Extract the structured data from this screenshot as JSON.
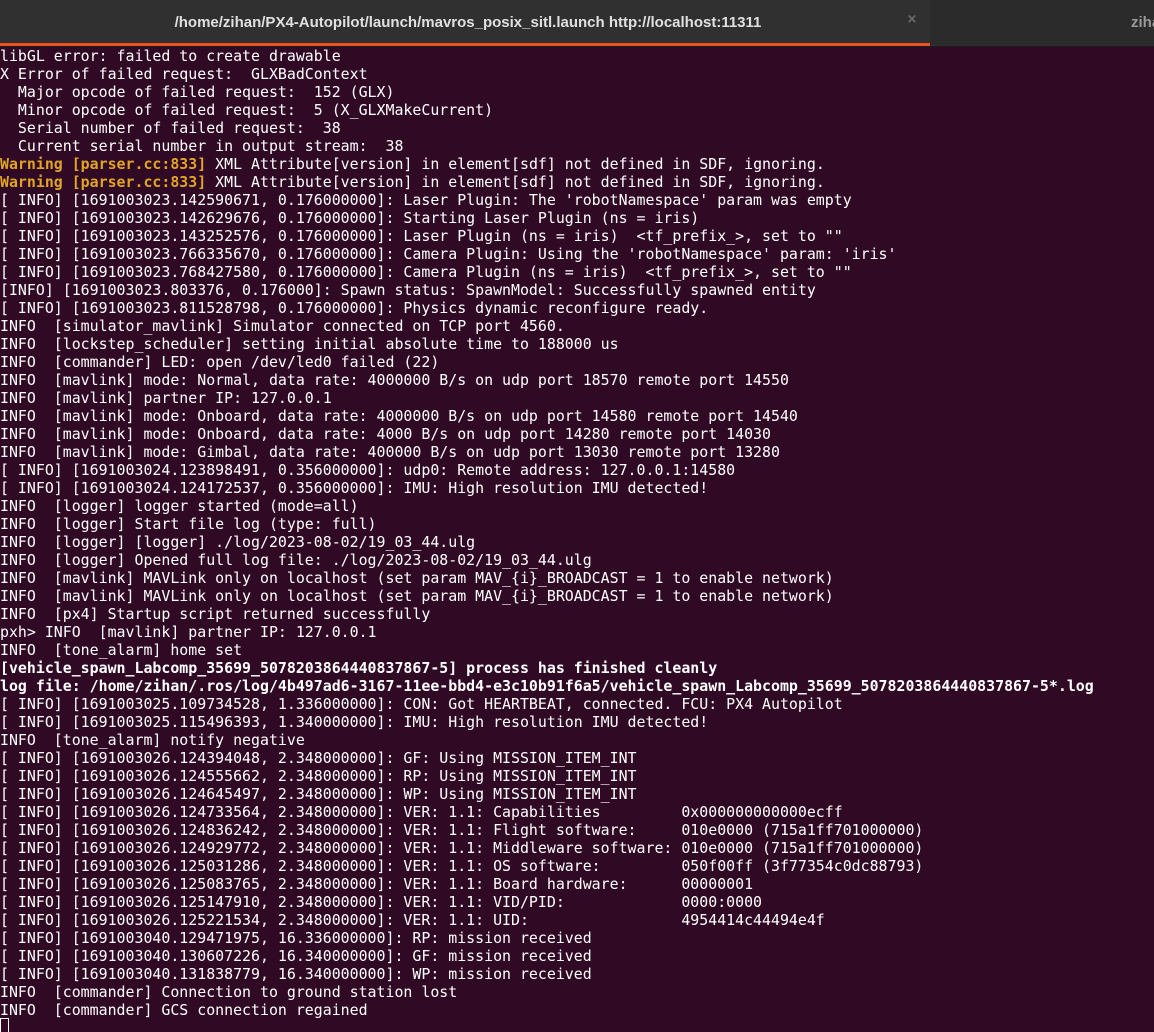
{
  "tabs": {
    "active_title": "/home/zihan/PX4-Autopilot/launch/mavros_posix_sitl.launch http://localhost:11311",
    "close_symbol": "×",
    "inactive_title": "ziha",
    "accent_color": "#e95420"
  },
  "colors": {
    "background": "#300a24",
    "warning": "#e0a526",
    "text": "#ffffff"
  },
  "terminal": {
    "lines": [
      {
        "text": "libGL error: failed to create drawable"
      },
      {
        "text": "X Error of failed request:  GLXBadContext"
      },
      {
        "text": "  Major opcode of failed request:  152 (GLX)"
      },
      {
        "text": "  Minor opcode of failed request:  5 (X_GLXMakeCurrent)"
      },
      {
        "text": "  Serial number of failed request:  38"
      },
      {
        "text": "  Current serial number in output stream:  38"
      },
      {
        "warn": "Warning [parser.cc:833]",
        "text": " XML Attribute[version] in element[sdf] not defined in SDF, ignoring."
      },
      {
        "warn": "Warning [parser.cc:833]",
        "text": " XML Attribute[version] in element[sdf] not defined in SDF, ignoring."
      },
      {
        "text": "[ INFO] [1691003023.142590671, 0.176000000]: Laser Plugin: The 'robotNamespace' param was empty"
      },
      {
        "text": "[ INFO] [1691003023.142629676, 0.176000000]: Starting Laser Plugin (ns = iris)"
      },
      {
        "text": "[ INFO] [1691003023.143252576, 0.176000000]: Laser Plugin (ns = iris)  <tf_prefix_>, set to \"\""
      },
      {
        "text": "[ INFO] [1691003023.766335670, 0.176000000]: Camera Plugin: Using the 'robotNamespace' param: 'iris'"
      },
      {
        "text": "[ INFO] [1691003023.768427580, 0.176000000]: Camera Plugin (ns = iris)  <tf_prefix_>, set to \"\""
      },
      {
        "text": "[INFO] [1691003023.803376, 0.176000]: Spawn status: SpawnModel: Successfully spawned entity"
      },
      {
        "text": "[ INFO] [1691003023.811528798, 0.176000000]: Physics dynamic reconfigure ready."
      },
      {
        "text": "INFO  [simulator_mavlink] Simulator connected on TCP port 4560."
      },
      {
        "text": "INFO  [lockstep_scheduler] setting initial absolute time to 188000 us"
      },
      {
        "text": "INFO  [commander] LED: open /dev/led0 failed (22)"
      },
      {
        "text": "INFO  [mavlink] mode: Normal, data rate: 4000000 B/s on udp port 18570 remote port 14550"
      },
      {
        "text": "INFO  [mavlink] partner IP: 127.0.0.1"
      },
      {
        "text": "INFO  [mavlink] mode: Onboard, data rate: 4000000 B/s on udp port 14580 remote port 14540"
      },
      {
        "text": "INFO  [mavlink] mode: Onboard, data rate: 4000 B/s on udp port 14280 remote port 14030"
      },
      {
        "text": "INFO  [mavlink] mode: Gimbal, data rate: 400000 B/s on udp port 13030 remote port 13280"
      },
      {
        "text": "[ INFO] [1691003024.123898491, 0.356000000]: udp0: Remote address: 127.0.0.1:14580"
      },
      {
        "text": "[ INFO] [1691003024.124172537, 0.356000000]: IMU: High resolution IMU detected!"
      },
      {
        "text": "INFO  [logger] logger started (mode=all)"
      },
      {
        "text": "INFO  [logger] Start file log (type: full)"
      },
      {
        "text": "INFO  [logger] [logger] ./log/2023-08-02/19_03_44.ulg"
      },
      {
        "text": "INFO  [logger] Opened full log file: ./log/2023-08-02/19_03_44.ulg"
      },
      {
        "text": "INFO  [mavlink] MAVLink only on localhost (set param MAV_{i}_BROADCAST = 1 to enable network)"
      },
      {
        "text": "INFO  [mavlink] MAVLink only on localhost (set param MAV_{i}_BROADCAST = 1 to enable network)"
      },
      {
        "text": "INFO  [px4] Startup script returned successfully"
      },
      {
        "text": "pxh> INFO  [mavlink] partner IP: 127.0.0.1"
      },
      {
        "text": "INFO  [tone_alarm] home set"
      },
      {
        "text": "[vehicle_spawn_Labcomp_35699_5078203864440837867-5] process has finished cleanly",
        "bold": true
      },
      {
        "text": "log file: /home/zihan/.ros/log/4b497ad6-3167-11ee-bbd4-e3c10b91f6a5/vehicle_spawn_Labcomp_35699_5078203864440837867-5*.log",
        "bold": true
      },
      {
        "text": "[ INFO] [1691003025.109734528, 1.336000000]: CON: Got HEARTBEAT, connected. FCU: PX4 Autopilot"
      },
      {
        "text": "[ INFO] [1691003025.115496393, 1.340000000]: IMU: High resolution IMU detected!"
      },
      {
        "text": "INFO  [tone_alarm] notify negative"
      },
      {
        "text": "[ INFO] [1691003026.124394048, 2.348000000]: GF: Using MISSION_ITEM_INT"
      },
      {
        "text": "[ INFO] [1691003026.124555662, 2.348000000]: RP: Using MISSION_ITEM_INT"
      },
      {
        "text": "[ INFO] [1691003026.124645497, 2.348000000]: WP: Using MISSION_ITEM_INT"
      },
      {
        "text": "[ INFO] [1691003026.124733564, 2.348000000]: VER: 1.1: Capabilities         0x000000000000ecff"
      },
      {
        "text": "[ INFO] [1691003026.124836242, 2.348000000]: VER: 1.1: Flight software:     010e0000 (715a1ff701000000)"
      },
      {
        "text": "[ INFO] [1691003026.124929772, 2.348000000]: VER: 1.1: Middleware software: 010e0000 (715a1ff701000000)"
      },
      {
        "text": "[ INFO] [1691003026.125031286, 2.348000000]: VER: 1.1: OS software:         050f00ff (3f77354c0dc88793)"
      },
      {
        "text": "[ INFO] [1691003026.125083765, 2.348000000]: VER: 1.1: Board hardware:      00000001"
      },
      {
        "text": "[ INFO] [1691003026.125147910, 2.348000000]: VER: 1.1: VID/PID:             0000:0000"
      },
      {
        "text": "[ INFO] [1691003026.125221534, 2.348000000]: VER: 1.1: UID:                 4954414c44494e4f"
      },
      {
        "text": "[ INFO] [1691003040.129471975, 16.336000000]: RP: mission received"
      },
      {
        "text": "[ INFO] [1691003040.130607226, 16.340000000]: GF: mission received"
      },
      {
        "text": "[ INFO] [1691003040.131838779, 16.340000000]: WP: mission received"
      },
      {
        "text": "INFO  [commander] Connection to ground station lost"
      },
      {
        "text": "INFO  [commander] GCS connection regained"
      }
    ]
  }
}
